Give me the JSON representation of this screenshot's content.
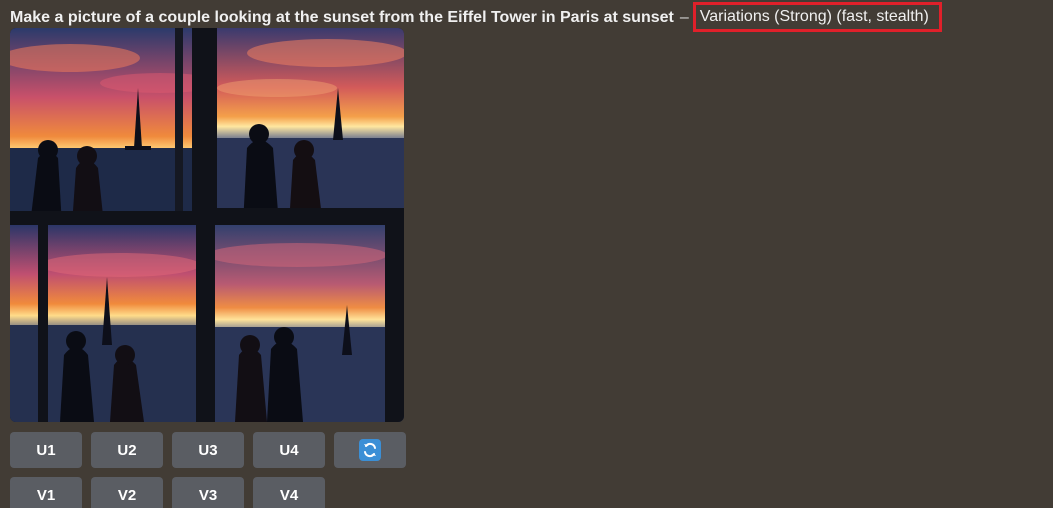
{
  "prompt": {
    "text": "Make a picture of a couple looking at the sunset from the Eiffel Tower in Paris at sunset",
    "separator": "–",
    "variation_label": "Variations (Strong) (fast, stealth)"
  },
  "colors": {
    "background": "#423c35",
    "button": "#5a5d63",
    "highlight_box": "#e0202a",
    "reroll_accent": "#3b8fd6"
  },
  "images": {
    "tiles": [
      {
        "description": "image-1"
      },
      {
        "description": "image-2"
      },
      {
        "description": "image-3"
      },
      {
        "description": "image-4"
      }
    ]
  },
  "buttons": {
    "upscale": [
      "U1",
      "U2",
      "U3",
      "U4"
    ],
    "variation": [
      "V1",
      "V2",
      "V3",
      "V4"
    ],
    "reroll_icon": "refresh-icon"
  }
}
